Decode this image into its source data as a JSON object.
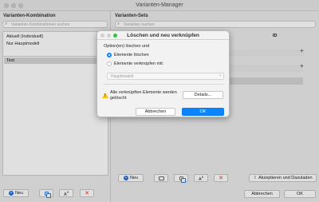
{
  "window": {
    "title": "Varianten-Manager"
  },
  "left_panel": {
    "title": "Varianten-Kombination",
    "search_placeholder": "Varianten-Kombinationen suchen",
    "items": [
      "Aktuell (Individuell)",
      "Nur Hauptmodell"
    ],
    "selected_item": "Test",
    "buttons": {
      "new_label": "Neu",
      "rename_label": "A",
      "rename_sup": "5"
    }
  },
  "right_panel": {
    "title": "Varianten-Sets",
    "search_placeholder": "Varianten suchen",
    "column_id": "ID",
    "buttons": {
      "new_label": "Neu",
      "rename_label": "A",
      "rename_sup": "5",
      "accept_label": "Akzeptieren und Dazuladen",
      "cancel_label": "Abbrechen",
      "ok_label": "OK"
    }
  },
  "dialog": {
    "title": "Löschen und neu verknüpfen",
    "options_label": "Option(en) löschen und",
    "radio_delete": "Elemente löschen",
    "radio_relink": "Elemente verknüpfen mit:",
    "select_value": "Hauptmodell",
    "warning_text_line1": "Alle verknüpften Elemente werden",
    "warning_text_line2": "gelöscht",
    "details_label": "Details...",
    "cancel_label": "Abbrechen",
    "ok_label": "OK"
  },
  "colors": {
    "accent": "#0a84ff",
    "warning": "#f5c518",
    "delete": "#e0382c"
  }
}
